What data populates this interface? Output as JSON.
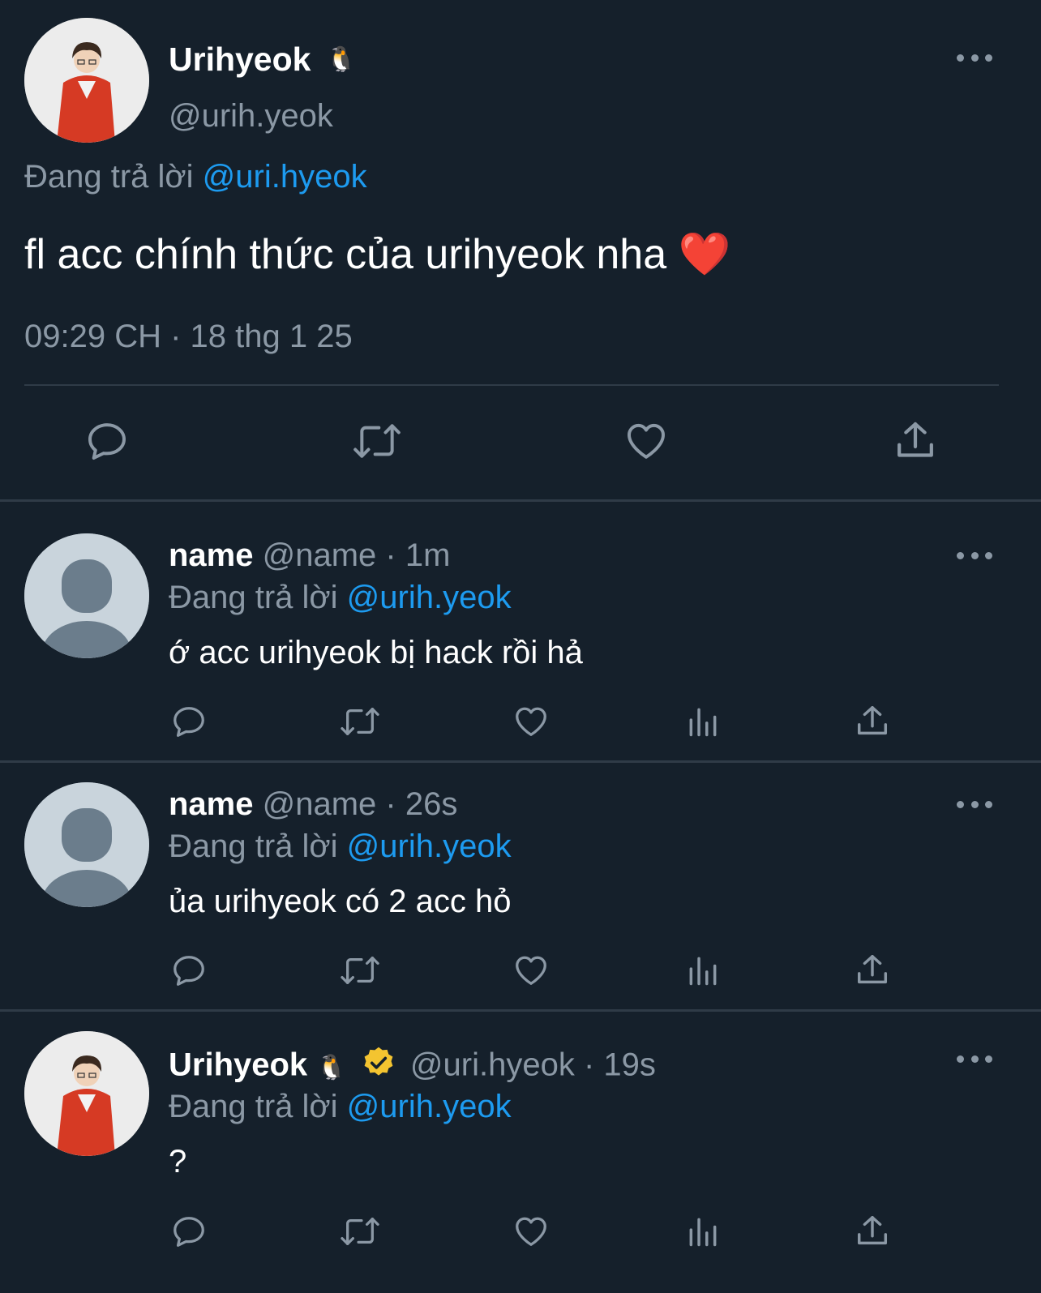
{
  "main_post": {
    "display_name": "Urihyeok",
    "emoji": "🐧",
    "handle": "@urih.yeok",
    "reply_prefix": "Đang trả lời",
    "reply_to": "@uri.hyeok",
    "text": "fl acc chính thức của urihyeok nha",
    "text_emoji": "❤️",
    "timestamp": "09:29 CH · 18 thg 1 25"
  },
  "replies": [
    {
      "display_name": "name",
      "handle": "@name",
      "time": "· 1m",
      "reply_prefix": "Đang trả lời",
      "reply_to": "@urih.yeok",
      "text": "ớ acc urihyeok bị hack rồi hả"
    },
    {
      "display_name": "name",
      "handle": "@name",
      "time": "· 26s",
      "reply_prefix": "Đang trả lời",
      "reply_to": "@urih.yeok",
      "text": "ủa urihyeok có 2 acc hỏ"
    },
    {
      "display_name": "Urihyeok",
      "emoji": "🐧",
      "handle": "@uri.hyeok",
      "time": "· 19s",
      "reply_prefix": "Đang trả lời",
      "reply_to": "@urih.yeok",
      "text": "?"
    }
  ],
  "colors": {
    "background": "#15202b",
    "link": "#1d9bf0",
    "muted": "#8b98a5",
    "verified_badge": "#f4c430"
  },
  "icons": [
    "reply-icon",
    "retweet-icon",
    "like-icon",
    "views-icon",
    "share-icon",
    "more-icon",
    "verified-badge-icon"
  ]
}
